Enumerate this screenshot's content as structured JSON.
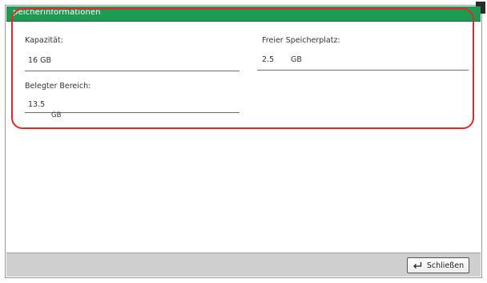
{
  "window": {
    "title": "peicherinformationen"
  },
  "fields": {
    "capacity": {
      "label": "Kapazität:",
      "value": "16 GB"
    },
    "used": {
      "label": "Belegter Bereich:",
      "value": "13.5",
      "unit": "GB"
    },
    "free": {
      "label": "Freier Speicherplatz:",
      "value": "2.5",
      "unit": "GB"
    }
  },
  "footer": {
    "close_label": "Schließen"
  },
  "colors": {
    "title_bar": "#1f9a52",
    "highlight": "#e02a2a",
    "footer": "#cfcfcf"
  },
  "icons": {
    "close_button_icon": "enter-return-icon"
  }
}
